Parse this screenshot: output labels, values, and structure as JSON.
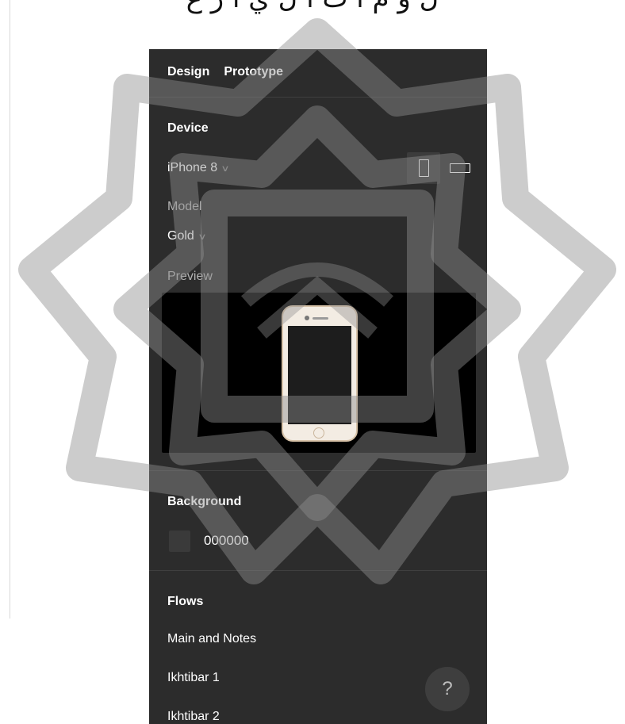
{
  "page_top_text": "ل و م ا ت ا ل ي ا ر ع",
  "tabs": [
    "Design",
    "Prototype"
  ],
  "device": {
    "section_title": "Device",
    "selected_device": "iPhone 8",
    "model_label": "Model",
    "selected_model": "Gold",
    "preview_label": "Preview"
  },
  "background": {
    "section_title": "Background",
    "color_hex": "000000"
  },
  "flows": {
    "section_title": "Flows",
    "items": [
      "Main and Notes",
      "Ikhtibar 1",
      "Ikhtibar 2"
    ]
  },
  "help_label": "?",
  "icons": {
    "dropdown": "chevron-down-icon",
    "portrait": "portrait-orientation-icon",
    "landscape": "landscape-orientation-icon",
    "device": "phone-icon"
  },
  "colors": {
    "panel_bg": "#2c2c2c",
    "preview_bg": "#000000",
    "phone_body": "#f3ece3",
    "phone_trim": "#d7c2a8",
    "watermark": "#8f8f8f"
  }
}
